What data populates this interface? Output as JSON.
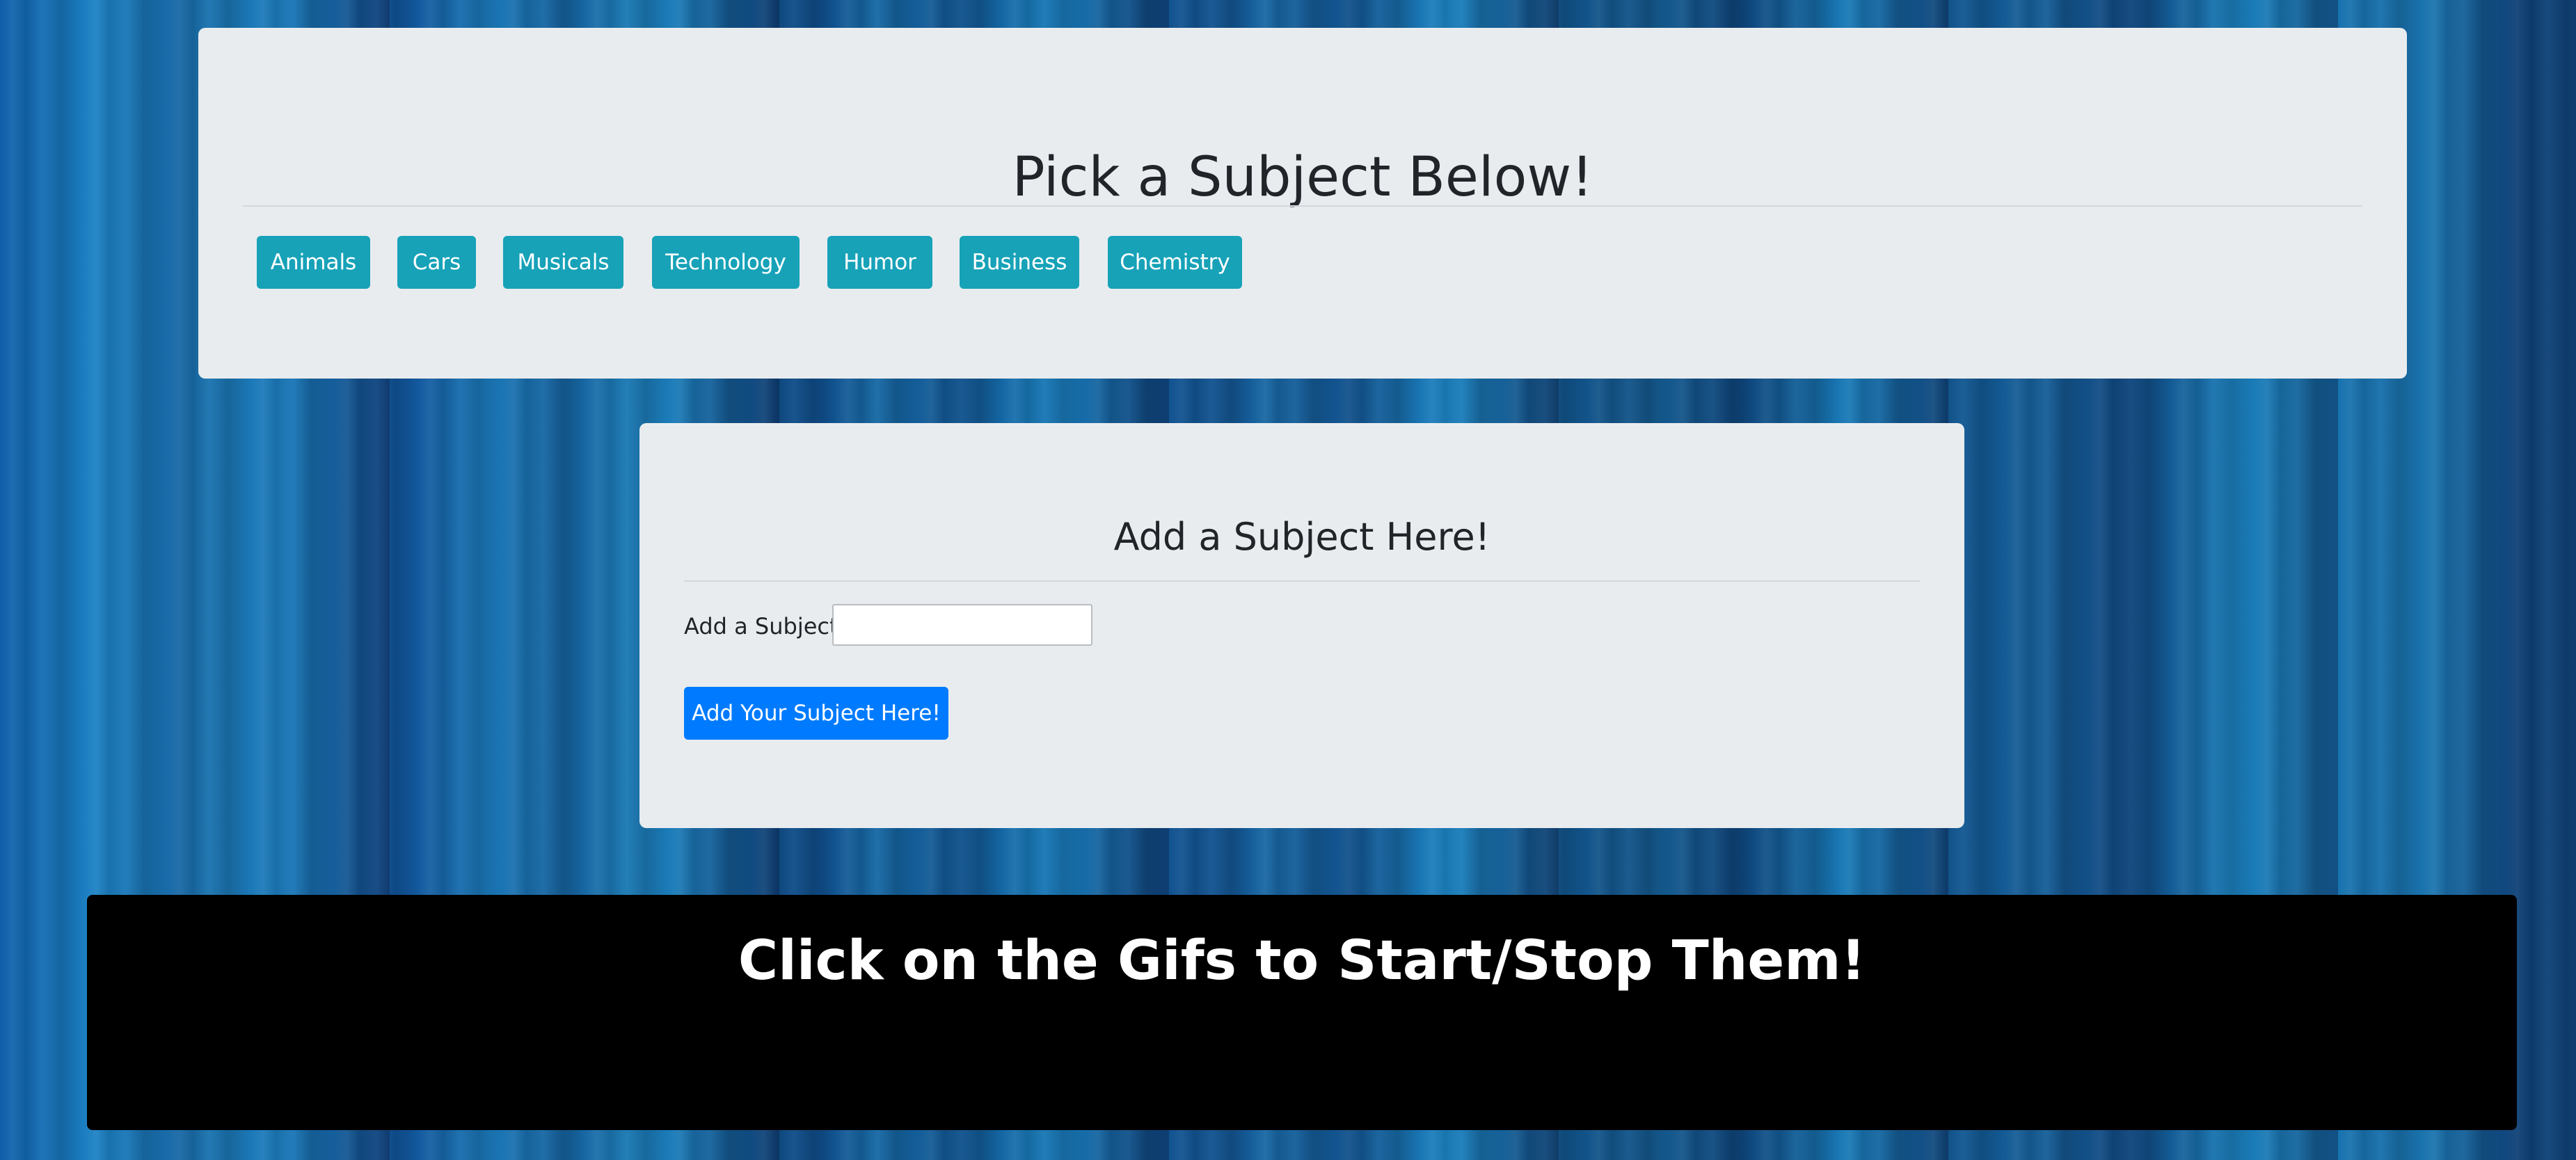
{
  "pick_section": {
    "title": "Pick a Subject Below!",
    "buttons": [
      "Animals",
      "Cars",
      "Musicals",
      "Technology",
      "Humor",
      "Business",
      "Chemistry"
    ]
  },
  "add_section": {
    "title": "Add a Subject Here!",
    "input_label": "Add a Subject!",
    "input_value": "",
    "submit_label": "Add Your Subject Here!"
  },
  "gif_section": {
    "title": "Click on the Gifs to Start/Stop Them!"
  },
  "colors": {
    "card_bg": "#e9ecef",
    "subject_button": "#17a2b8",
    "primary_button": "#007bff",
    "gif_panel_bg": "#000000"
  }
}
